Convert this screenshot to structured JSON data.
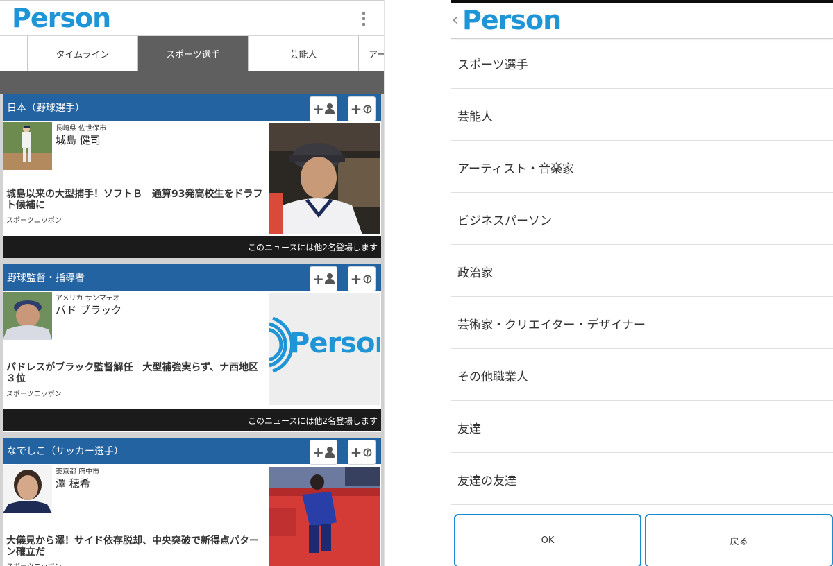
{
  "left": {
    "logo": "Person",
    "tabs": [
      "",
      "タイムライン",
      "スポーツ選手",
      "芸能人",
      "アー"
    ],
    "active_tab": "スポーツ選手",
    "cards": [
      {
        "category": "日本（野球選手）",
        "location": "長崎県 佐世保市",
        "name": "城島 健司",
        "headline": "城島以来の大型捕手！ソフトＢ　通算93発高校生をドラフト候補に",
        "source": "スポーツニッポン",
        "footer": "このニュースには他2名登場します"
      },
      {
        "category": "野球監督・指導者",
        "location": "アメリカ サンマテオ",
        "name": "バド ブラック",
        "headline": "パドレスがブラック監督解任　大型補強実らず、ナ西地区３位",
        "source": "スポーツニッポン",
        "footer": "このニュースには他2名登場します",
        "placeholder_logo": "Person"
      },
      {
        "category": "なでしこ（サッカー選手）",
        "location": "東京都 府中市",
        "name": "澤 穂希",
        "headline": "大儀見から澤！サイド依存脱却、中央突破で新得点パターン確立だ",
        "source": "スポーツニッポン"
      }
    ]
  },
  "right": {
    "back_label": "‹",
    "logo": "Person",
    "menu_items": [
      "スポーツ選手",
      "芸能人",
      "アーティスト・音楽家",
      "ビジネスパーソン",
      "政治家",
      "芸術家・クリエイター・デザイナー",
      "その他職業人",
      "友達",
      "友達の友達"
    ],
    "ok_label": "OK",
    "back_button_label": "戻る"
  },
  "colors": {
    "brand": "#1d95d6",
    "card_header": "#2363a1",
    "tab_active": "#5f5f5f",
    "footer_bar": "#1b1b1b",
    "button_border": "#1a8ad1"
  }
}
